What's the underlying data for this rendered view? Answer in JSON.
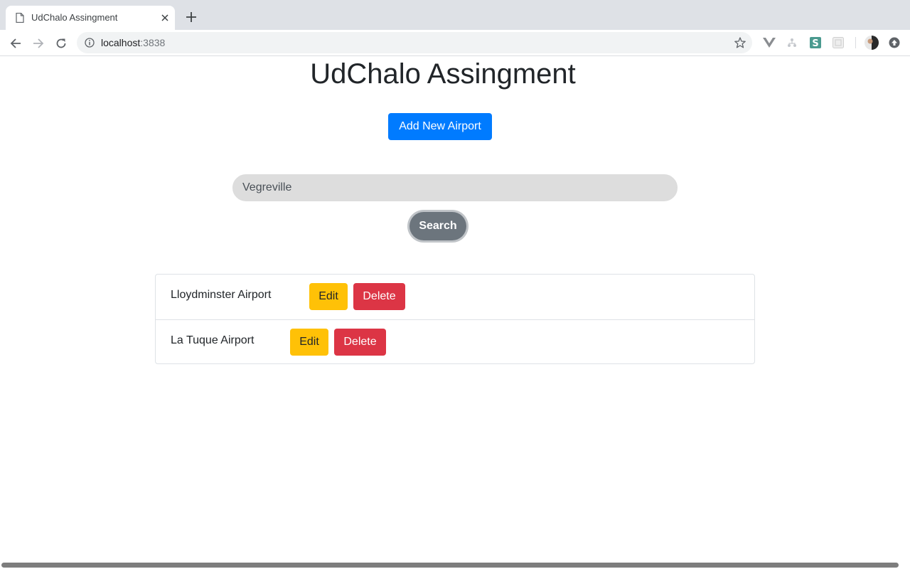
{
  "browser": {
    "tab_title": "UdChalo Assingment",
    "url_host": "localhost",
    "url_port": ":3838"
  },
  "page": {
    "title": "UdChalo Assingment",
    "add_button_label": "Add New Airport",
    "search": {
      "value": "Vegreville",
      "button_label": "Search"
    },
    "airports": [
      {
        "name": "Lloydminster Airport",
        "edit_label": "Edit",
        "delete_label": "Delete"
      },
      {
        "name": "La Tuque Airport",
        "edit_label": "Edit",
        "delete_label": "Delete"
      }
    ]
  },
  "colors": {
    "primary": "#007bff",
    "warning": "#ffc107",
    "danger": "#dc3545",
    "secondary": "#6c757d"
  }
}
